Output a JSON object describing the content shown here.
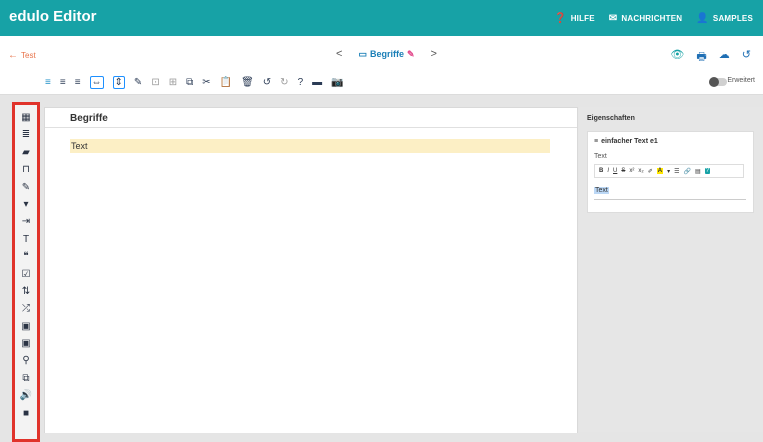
{
  "app": {
    "title": "edulo Editor"
  },
  "topnav": {
    "help": "HILFE",
    "messages": "NACHRICHTEN",
    "samples": "SAMPLES"
  },
  "crumb": {
    "back": "Test",
    "prev": "<",
    "doc_title": "Begriffe",
    "next": ">"
  },
  "toolbar": {
    "toggle_label": "Erweitert"
  },
  "sidebar": {
    "icons": [
      "table",
      "list",
      "book",
      "inbox",
      "edit",
      "dropdown",
      "login",
      "text",
      "quote",
      "checkbox",
      "sort",
      "shuffle",
      "image",
      "image-plus",
      "marker",
      "copy",
      "audio",
      "video"
    ]
  },
  "editor": {
    "title": "Begriffe",
    "block_text": "Text"
  },
  "props": {
    "header": "Eigenschaften",
    "element_title": "einfacher Text e1",
    "field_label": "Text",
    "field_value": "Text"
  },
  "colors": {
    "topbar": "#17a2a6",
    "sidebar_border": "#e0332b",
    "highlight": "#fcefc5"
  }
}
